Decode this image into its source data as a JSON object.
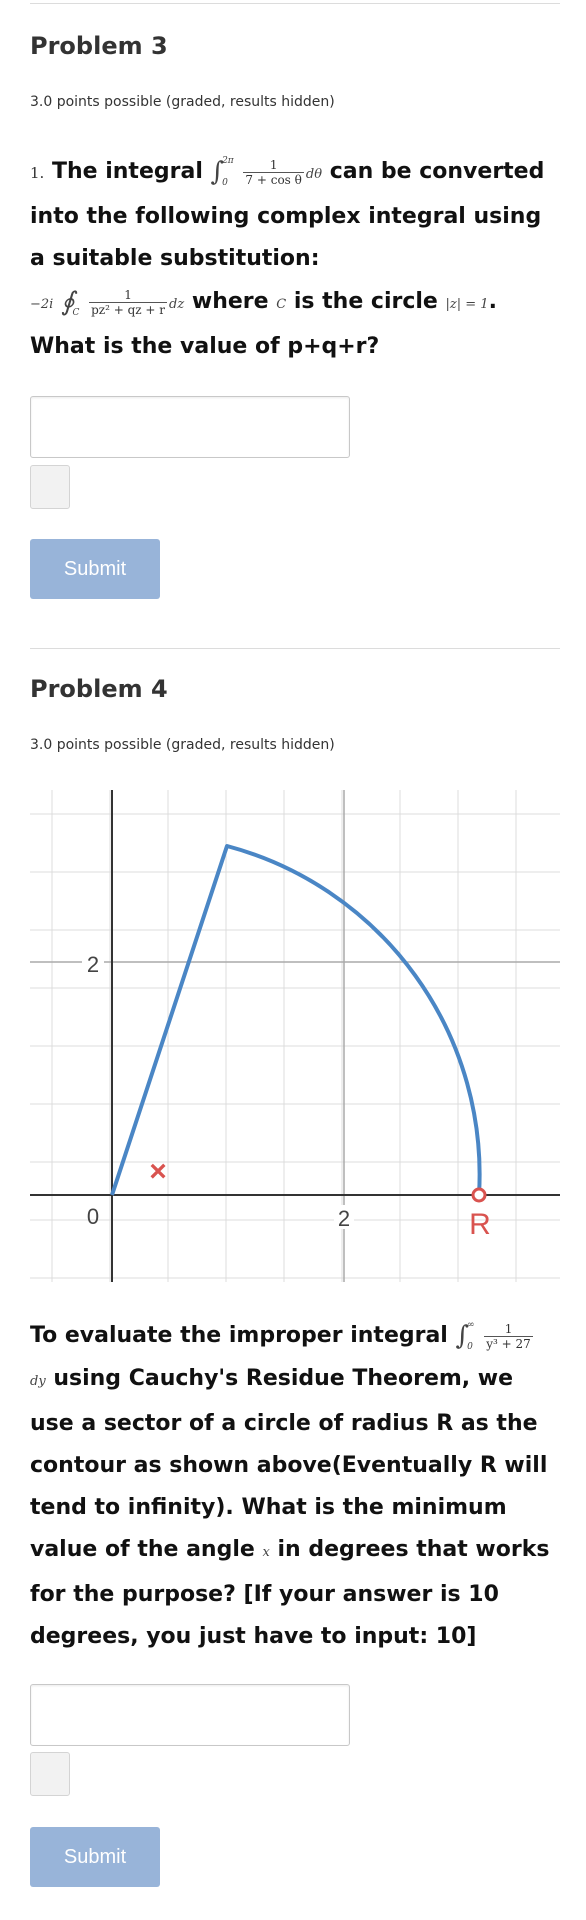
{
  "problem3": {
    "title": "Problem 3",
    "meta": "3.0 points possible (graded, results hidden)",
    "number": "1.",
    "text_a": "The integral",
    "int_upper": "2π",
    "int_lower": "0",
    "frac_num": "1",
    "frac_den": "7 + cos θ",
    "dtheta": "dθ",
    "text_b": "can be converted into the following complex integral using a suitable substitution:",
    "coef": "−2i",
    "c_lower": "C",
    "frac2_num": "1",
    "frac2_den": "pz² + qz + r",
    "dz": "dz",
    "text_c": "where",
    "c_sym": "C",
    "text_d": "is the circle",
    "circle": "|z| = 1",
    "text_e": ". What is the value of p+q+r?",
    "input_value": "",
    "submit_label": "Submit"
  },
  "problem4": {
    "title": "Problem 4",
    "meta": "3.0 points possible (graded, results hidden)",
    "graph": {
      "tick_2_y": "2",
      "tick_0": "0",
      "tick_2_x": "2",
      "label_R": "R",
      "marker": "×",
      "line_color": "#4a86c5",
      "marker_color": "#d9534f"
    },
    "text_a": "To evaluate the improper integral",
    "int_upper": "∞",
    "int_lower": "0",
    "frac_num": "1",
    "frac_den": "y³ + 27",
    "dy": "dy",
    "text_b": "using Cauchy's Residue Theorem, we use a sector of a circle of radius R as the contour as shown above(Eventually R will tend to infinity). What is the minimum value of the angle",
    "x_sym": "x",
    "text_c": "in degrees that works for the purpose? [If your answer is 10 degrees, you just have to input: 10]",
    "input_value": "",
    "submit_label": "Submit"
  }
}
